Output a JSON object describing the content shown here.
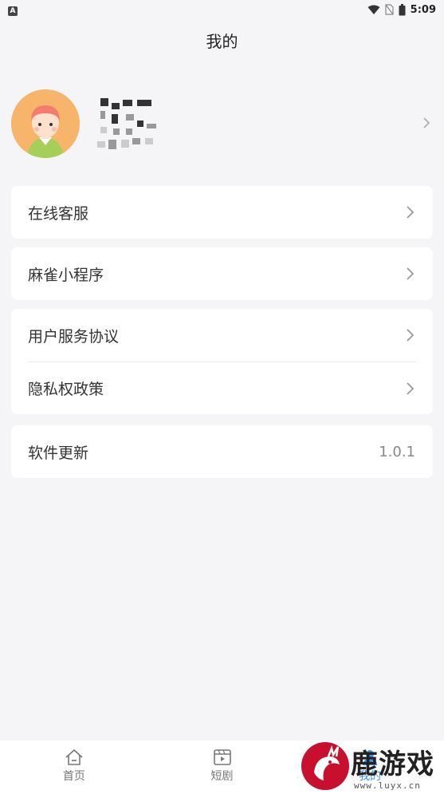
{
  "status_bar": {
    "left_badge": "A",
    "time": "5:09",
    "icons": [
      "wifi-icon",
      "no-sim-icon",
      "battery-icon"
    ]
  },
  "header": {
    "title": "我的"
  },
  "profile": {
    "avatar_icon": "avatar-icon",
    "chevron_icon": "chevron-right-icon"
  },
  "menu": {
    "online_service": "在线客服",
    "mahjong_miniprogram": "麻雀小程序",
    "user_agreement": "用户服务协议",
    "privacy_policy": "隐私权政策",
    "software_update": "软件更新",
    "version": "1.0.1"
  },
  "tabs": [
    {
      "label": "首页",
      "icon": "home-icon"
    },
    {
      "label": "短剧",
      "icon": "video-icon"
    },
    {
      "label": "我的",
      "icon": "profile-icon",
      "active": true
    }
  ],
  "watermark": {
    "text": "鹿游戏",
    "url": "www.luyx.cn"
  },
  "colors": {
    "accent": "#3a8ff0",
    "avatar_bg": "#f6b56a",
    "background": "#f5f5f7"
  }
}
